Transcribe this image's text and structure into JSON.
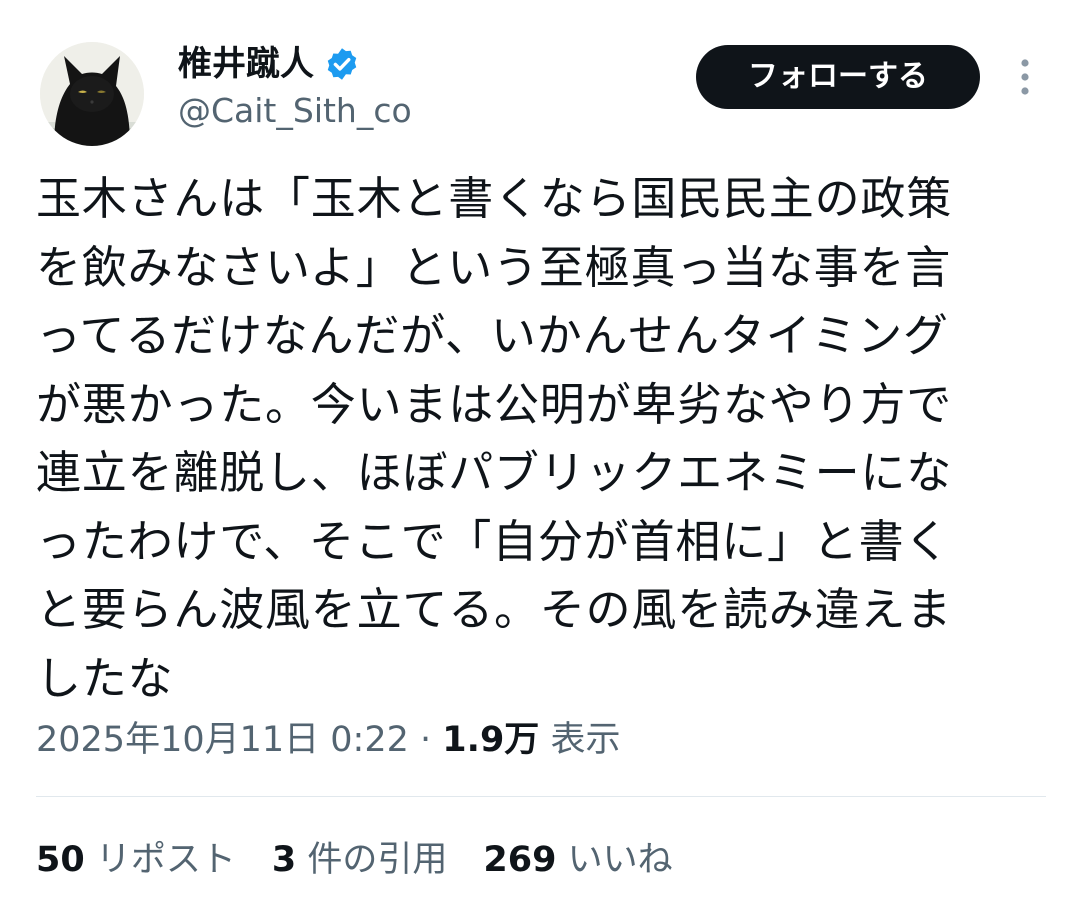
{
  "author": {
    "display_name": "椎井蹴人",
    "handle": "@Cait_Sith_co",
    "avatar_icon": "black-cat-avatar",
    "verified_icon": "verified-badge-icon",
    "verified_color": "#1d9bf0"
  },
  "actions": {
    "follow_label": "フォローする",
    "more_icon": "more-vertical-icon"
  },
  "tweet": {
    "lines": [
      "玉木さんは「玉木と書くなら国民民主の政策",
      "を飲みなさいよ」という至極真っ当な事を言",
      "ってるだけなんだが、いかんせんタイミング",
      "が悪かった。今いまは公明が卑劣なやり方で",
      "連立を離脱し、ほぼパブリックエネミーにな",
      "ったわけで、そこで「自分が首相に」と書く",
      "と要らん波風を立てる。その風を読み違えま",
      "したな"
    ]
  },
  "meta": {
    "timestamp": "2025年10月11日 0:22",
    "separator": "·",
    "views_count": "1.9万",
    "views_label": "表示"
  },
  "stats": {
    "reposts_count": "50",
    "reposts_label": "リポスト",
    "quotes_count": "3",
    "quotes_label": "件の引用",
    "likes_count": "269",
    "likes_label": "いいね"
  },
  "colors": {
    "text_primary": "#0f1419",
    "text_secondary": "#536471",
    "follow_button_bg": "#0f1419",
    "divider": "#e1e8ed"
  }
}
